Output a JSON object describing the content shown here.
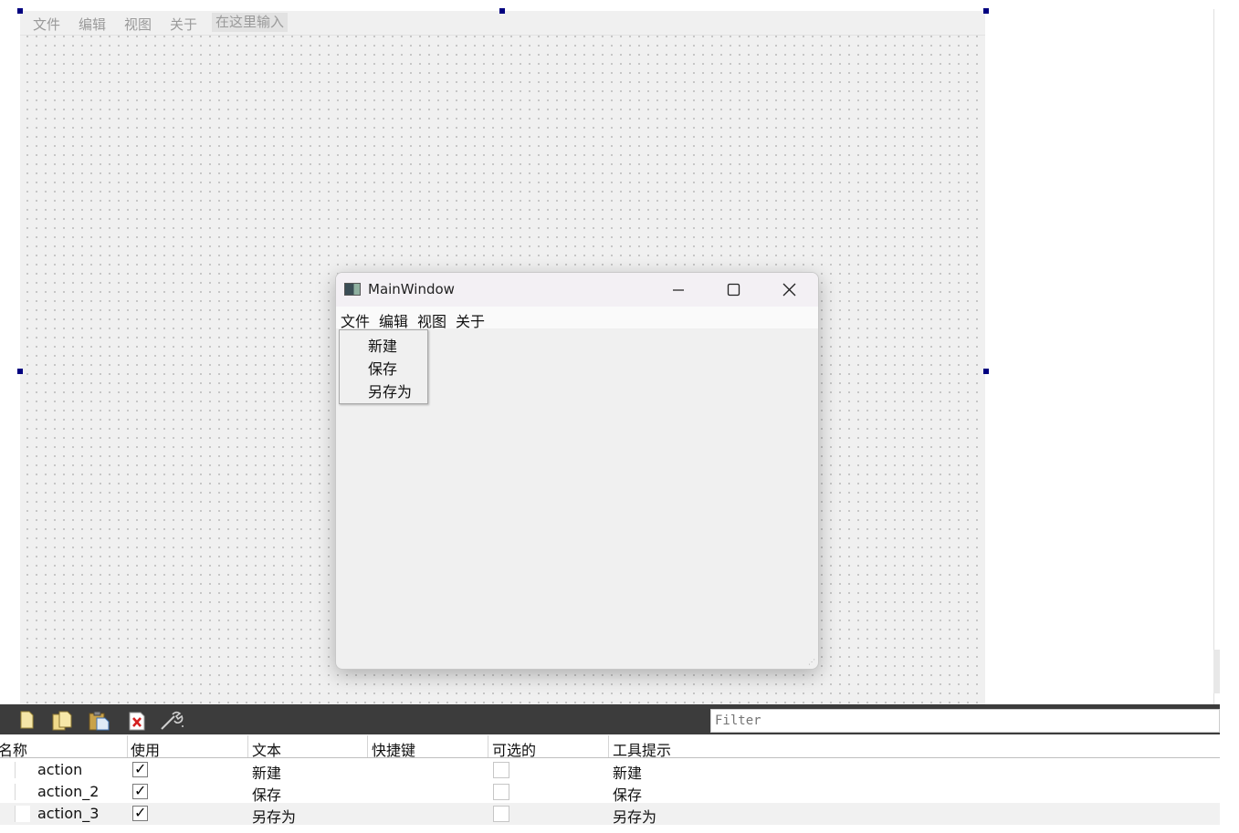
{
  "canvas_menubar": {
    "items": [
      "文件",
      "编辑",
      "视图",
      "关于"
    ],
    "type_here": "在这里输入"
  },
  "preview_window": {
    "title": "MainWindow",
    "controls": [
      "minimize-icon",
      "maximize-icon",
      "close-icon"
    ],
    "menus": [
      "文件",
      "编辑",
      "视图",
      "关于"
    ],
    "dropdown_items": [
      "新建",
      "保存",
      "另存为"
    ]
  },
  "action_editor": {
    "toolbar_icons": [
      "new-action-icon",
      "copy-icon",
      "paste-icon",
      "delete-icon",
      "configure-icon"
    ],
    "filter_placeholder": "Filter",
    "columns": [
      "名称",
      "使用",
      "文本",
      "快捷键",
      "可选的",
      "工具提示"
    ],
    "rows": [
      {
        "name": "action",
        "used": true,
        "text": "新建",
        "shortcut": "",
        "checkable": false,
        "tooltip": "新建"
      },
      {
        "name": "action_2",
        "used": true,
        "text": "保存",
        "shortcut": "",
        "checkable": false,
        "tooltip": "保存"
      },
      {
        "name": "action_3",
        "used": true,
        "text": "另存为",
        "shortcut": "",
        "checkable": false,
        "tooltip": "另存为"
      }
    ],
    "check_glyph": "✓"
  },
  "colors": {
    "selection_handle": "#000080",
    "toolbar_bg": "#3c3c3c",
    "canvas_bg": "#f0f0f0"
  }
}
